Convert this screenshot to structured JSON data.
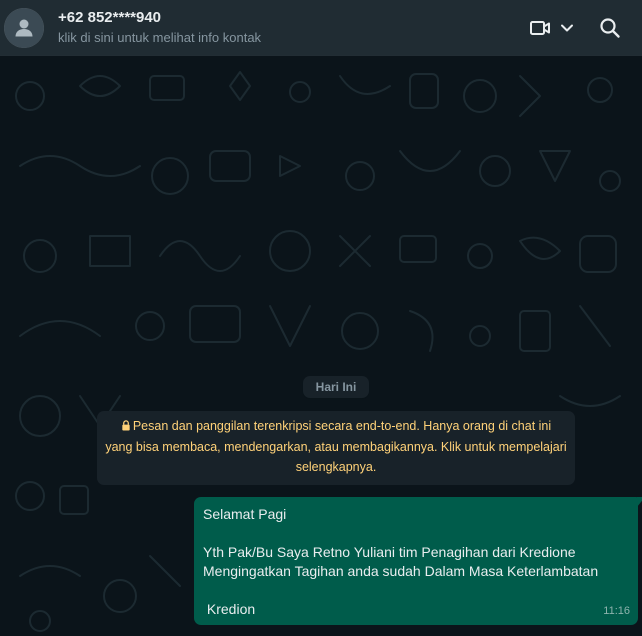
{
  "header": {
    "contact_name": "+62 852****940",
    "contact_subtitle": "klik di sini untuk melihat info kontak",
    "icons": [
      "default-avatar-icon",
      "video-call-icon",
      "chevron-down-icon",
      "search-icon"
    ]
  },
  "chat": {
    "day_label": "Hari Ini",
    "encryption_notice": {
      "icon": "lock-icon",
      "lines": [
        "Pesan dan panggilan terenkripsi secara end-to-end. Hanya orang di chat ini",
        "yang bisa membaca, mendengarkan, atau membagikannya. Klik untuk mempelajari",
        "selengkapnya."
      ]
    },
    "messages": [
      {
        "direction": "outgoing",
        "lines": [
          "Selamat Pagi",
          "",
          "Yth Pak/Bu Saya Retno Yuliani tim Penagihan dari Kredione",
          "Mengingatkan Tagihan anda sudah Dalam Masa Keterlambatan",
          "",
          " Kredion"
        ],
        "time": "11:16"
      }
    ]
  },
  "colors": {
    "header_bg": "#202c33",
    "chat_bg": "#0b141a",
    "outgoing_bubble": "#005c4b",
    "system_chip": "#182229",
    "notice_text": "#ffd279",
    "primary_text": "#e9edef",
    "secondary_text": "#8696a0"
  }
}
